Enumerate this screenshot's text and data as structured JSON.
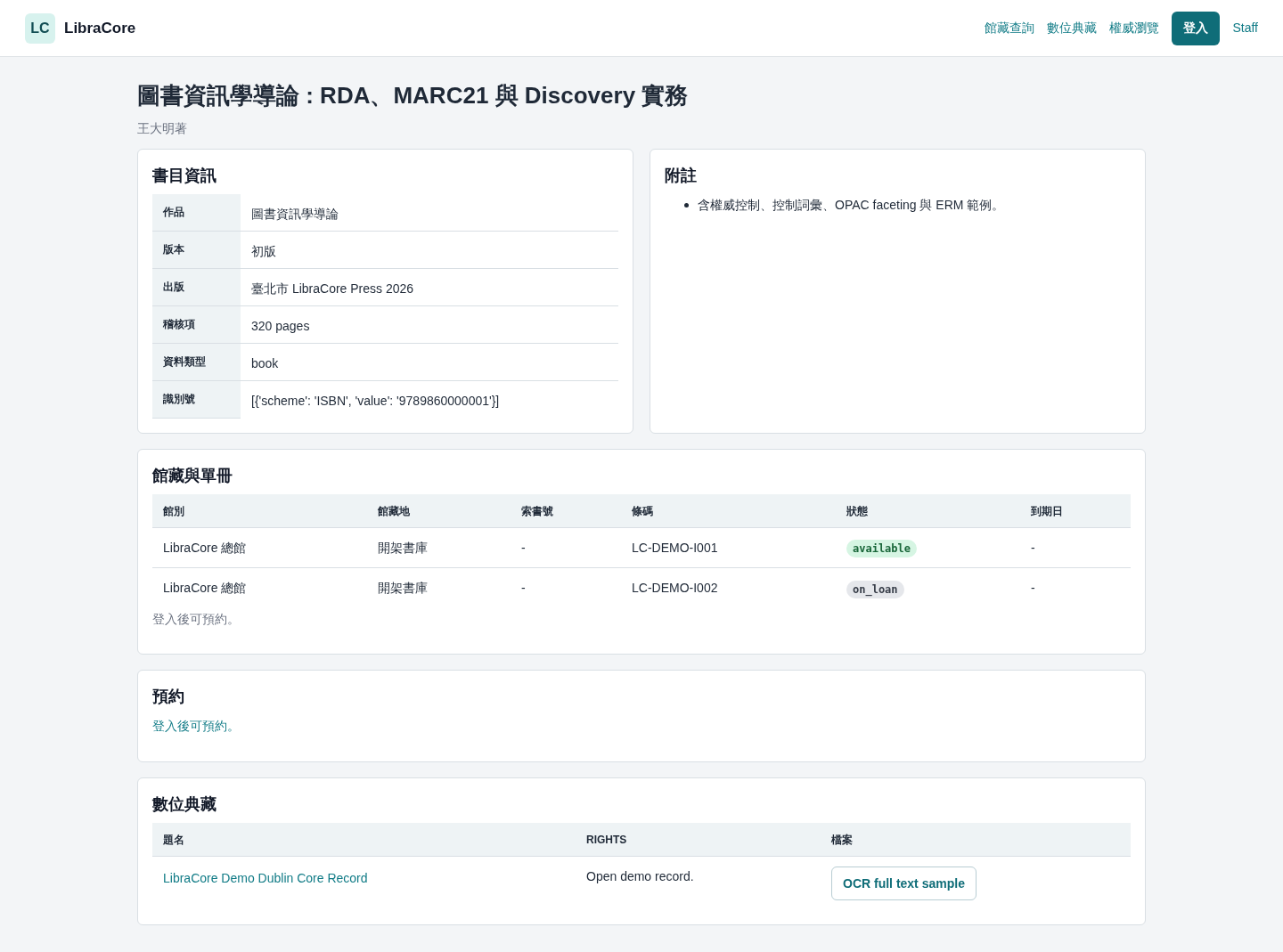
{
  "header": {
    "logo_mark": "LC",
    "brand": "LibraCore",
    "nav": [
      {
        "label": "館藏查詢",
        "kind": "link"
      },
      {
        "label": "數位典藏",
        "kind": "link"
      },
      {
        "label": "權威瀏覽",
        "kind": "link"
      },
      {
        "label": "登入",
        "kind": "button"
      },
      {
        "label": "Staff",
        "kind": "link"
      }
    ]
  },
  "record": {
    "title": "圖書資訊學導論 : RDA、MARC21 與 Discovery 實務",
    "author": "王大明著"
  },
  "bibliographic": {
    "heading": "書目資訊",
    "fields": [
      {
        "label": "作品",
        "value": "圖書資訊學導論"
      },
      {
        "label": "版本",
        "value": "初版"
      },
      {
        "label": "出版",
        "value": "臺北市 LibraCore Press 2026"
      },
      {
        "label": "稽核項",
        "value": "320 pages"
      },
      {
        "label": "資料類型",
        "value": "book"
      },
      {
        "label": "識別號",
        "value": "[{'scheme': 'ISBN', 'value': '9789860000001'}]"
      }
    ]
  },
  "notes": {
    "heading": "附註",
    "items": [
      "含權威控制、控制詞彙、OPAC faceting 與 ERM 範例。"
    ]
  },
  "holdings": {
    "heading": "館藏與單冊",
    "columns": [
      "館別",
      "館藏地",
      "索書號",
      "條碼",
      "狀態",
      "到期日"
    ],
    "rows": [
      {
        "library": "LibraCore 總館",
        "location": "開架書庫",
        "call_number": "-",
        "barcode": "LC-DEMO-I001",
        "status": {
          "label": "available",
          "color": "#d6f5e3"
        },
        "due_date": "-"
      },
      {
        "library": "LibraCore 總館",
        "location": "開架書庫",
        "call_number": "-",
        "barcode": "LC-DEMO-I002",
        "status": {
          "label": "on_loan",
          "color": "#e5e7eb"
        },
        "due_date": "-"
      }
    ],
    "note": "登入後可預約。"
  },
  "reservation": {
    "heading": "預約",
    "message": "登入後可預約。"
  },
  "digital_collection": {
    "heading": "數位典藏",
    "columns": [
      "題名",
      "RIGHTS",
      "檔案"
    ],
    "rows": [
      {
        "title": "LibraCore Demo Dublin Core Record",
        "rights": "Open demo record.",
        "file": "OCR full text sample"
      }
    ]
  }
}
